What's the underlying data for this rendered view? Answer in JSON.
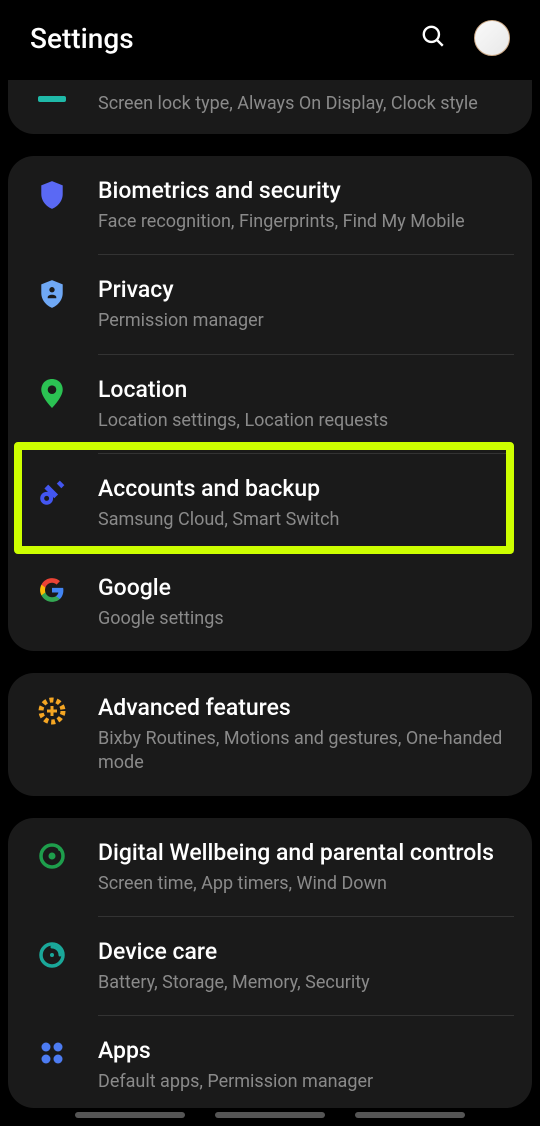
{
  "header": {
    "title": "Settings"
  },
  "groups": [
    {
      "items": [
        {
          "sub": "Screen lock type, Always On Display, Clock style"
        }
      ]
    },
    {
      "items": [
        {
          "title": "Biometrics and security",
          "sub": "Face recognition, Fingerprints, Find My Mobile"
        },
        {
          "title": "Privacy",
          "sub": "Permission manager"
        },
        {
          "title": "Location",
          "sub": "Location settings, Location requests"
        },
        {
          "title": "Accounts and backup",
          "sub": "Samsung Cloud, Smart Switch"
        },
        {
          "title": "Google",
          "sub": "Google settings"
        }
      ]
    },
    {
      "items": [
        {
          "title": "Advanced features",
          "sub": "Bixby Routines, Motions and gestures, One-handed mode"
        }
      ]
    },
    {
      "items": [
        {
          "title": "Digital Wellbeing and parental controls",
          "sub": "Screen time, App timers, Wind Down"
        },
        {
          "title": "Device care",
          "sub": "Battery, Storage, Memory, Security"
        },
        {
          "title": "Apps",
          "sub": "Default apps, Permission manager"
        }
      ]
    }
  ]
}
